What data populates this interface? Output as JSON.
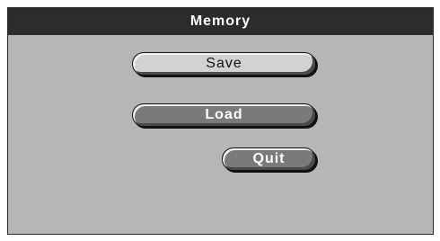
{
  "window": {
    "title": "Memory"
  },
  "buttons": {
    "save_label": "Save",
    "load_label": "Load",
    "quit_label": "Quit"
  }
}
